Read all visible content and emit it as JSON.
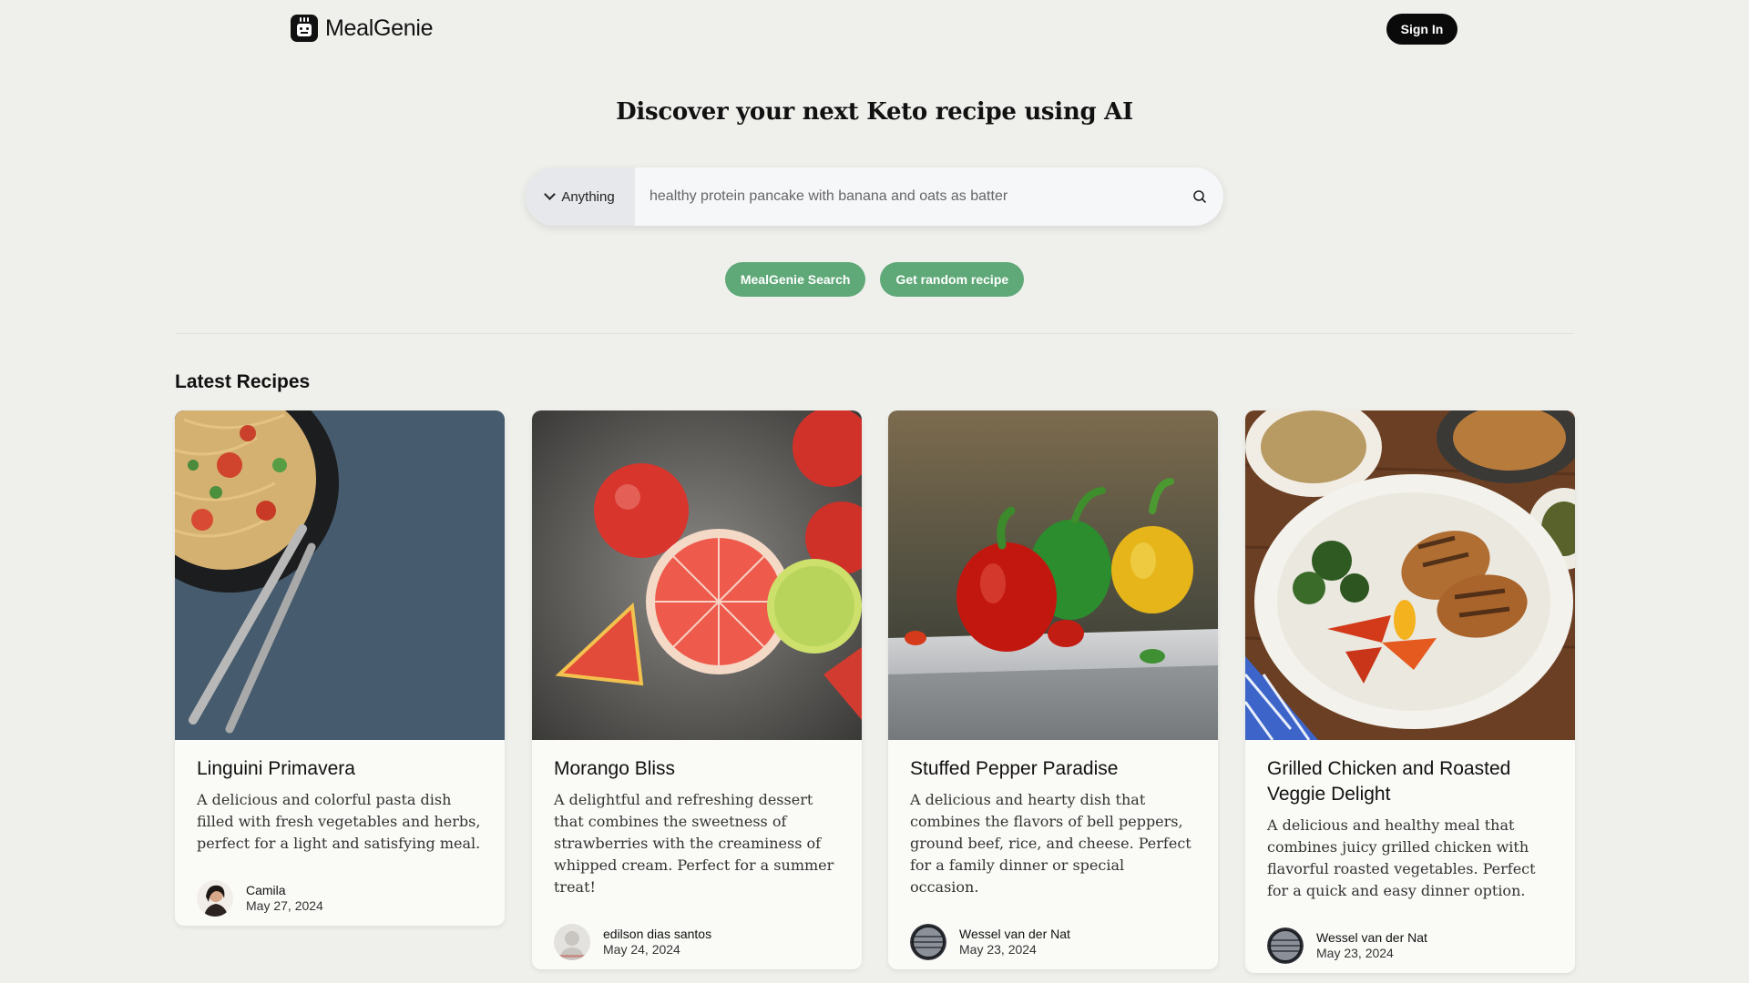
{
  "header": {
    "brand": "MealGenie",
    "sign_in": "Sign In"
  },
  "hero": {
    "title_prefix": "Discover your next ",
    "title_highlight": "Keto",
    "title_suffix": " recipe using AI"
  },
  "search": {
    "selected_option": "Anything",
    "placeholder": "healthy protein pancake with banana and oats as batter"
  },
  "actions": {
    "primary": "MealGenie Search",
    "secondary": "Get random recipe"
  },
  "latest": {
    "heading": "Latest Recipes",
    "recipes": [
      {
        "title": "Linguini Primavera",
        "description": "A delicious and colorful pasta dish filled with fresh vegetables and herbs, perfect for a light and satisfying meal.",
        "author": "Camila",
        "date": "May 27, 2024"
      },
      {
        "title": "Morango Bliss",
        "description": "A delightful and refreshing dessert that combines the sweetness of strawberries with the creaminess of whipped cream. Perfect for a summer treat!",
        "author": "edilson dias santos",
        "date": "May 24, 2024"
      },
      {
        "title": "Stuffed Pepper Paradise",
        "description": "A delicious and hearty dish that combines the flavors of bell peppers, ground beef, rice, and cheese. Perfect for a family dinner or special occasion.",
        "author": "Wessel van der Nat",
        "date": "May 23, 2024"
      },
      {
        "title": "Grilled Chicken and Roasted Veggie Delight",
        "description": "A delicious and healthy meal that combines juicy grilled chicken with flavorful roasted vegetables. Perfect for a quick and easy dinner option.",
        "author": "Wessel van der Nat",
        "date": "May 23, 2024"
      }
    ]
  },
  "colors": {
    "background": "#eff0ec",
    "accent_green": "#5fa878",
    "button_dark": "#0a0a0a"
  }
}
